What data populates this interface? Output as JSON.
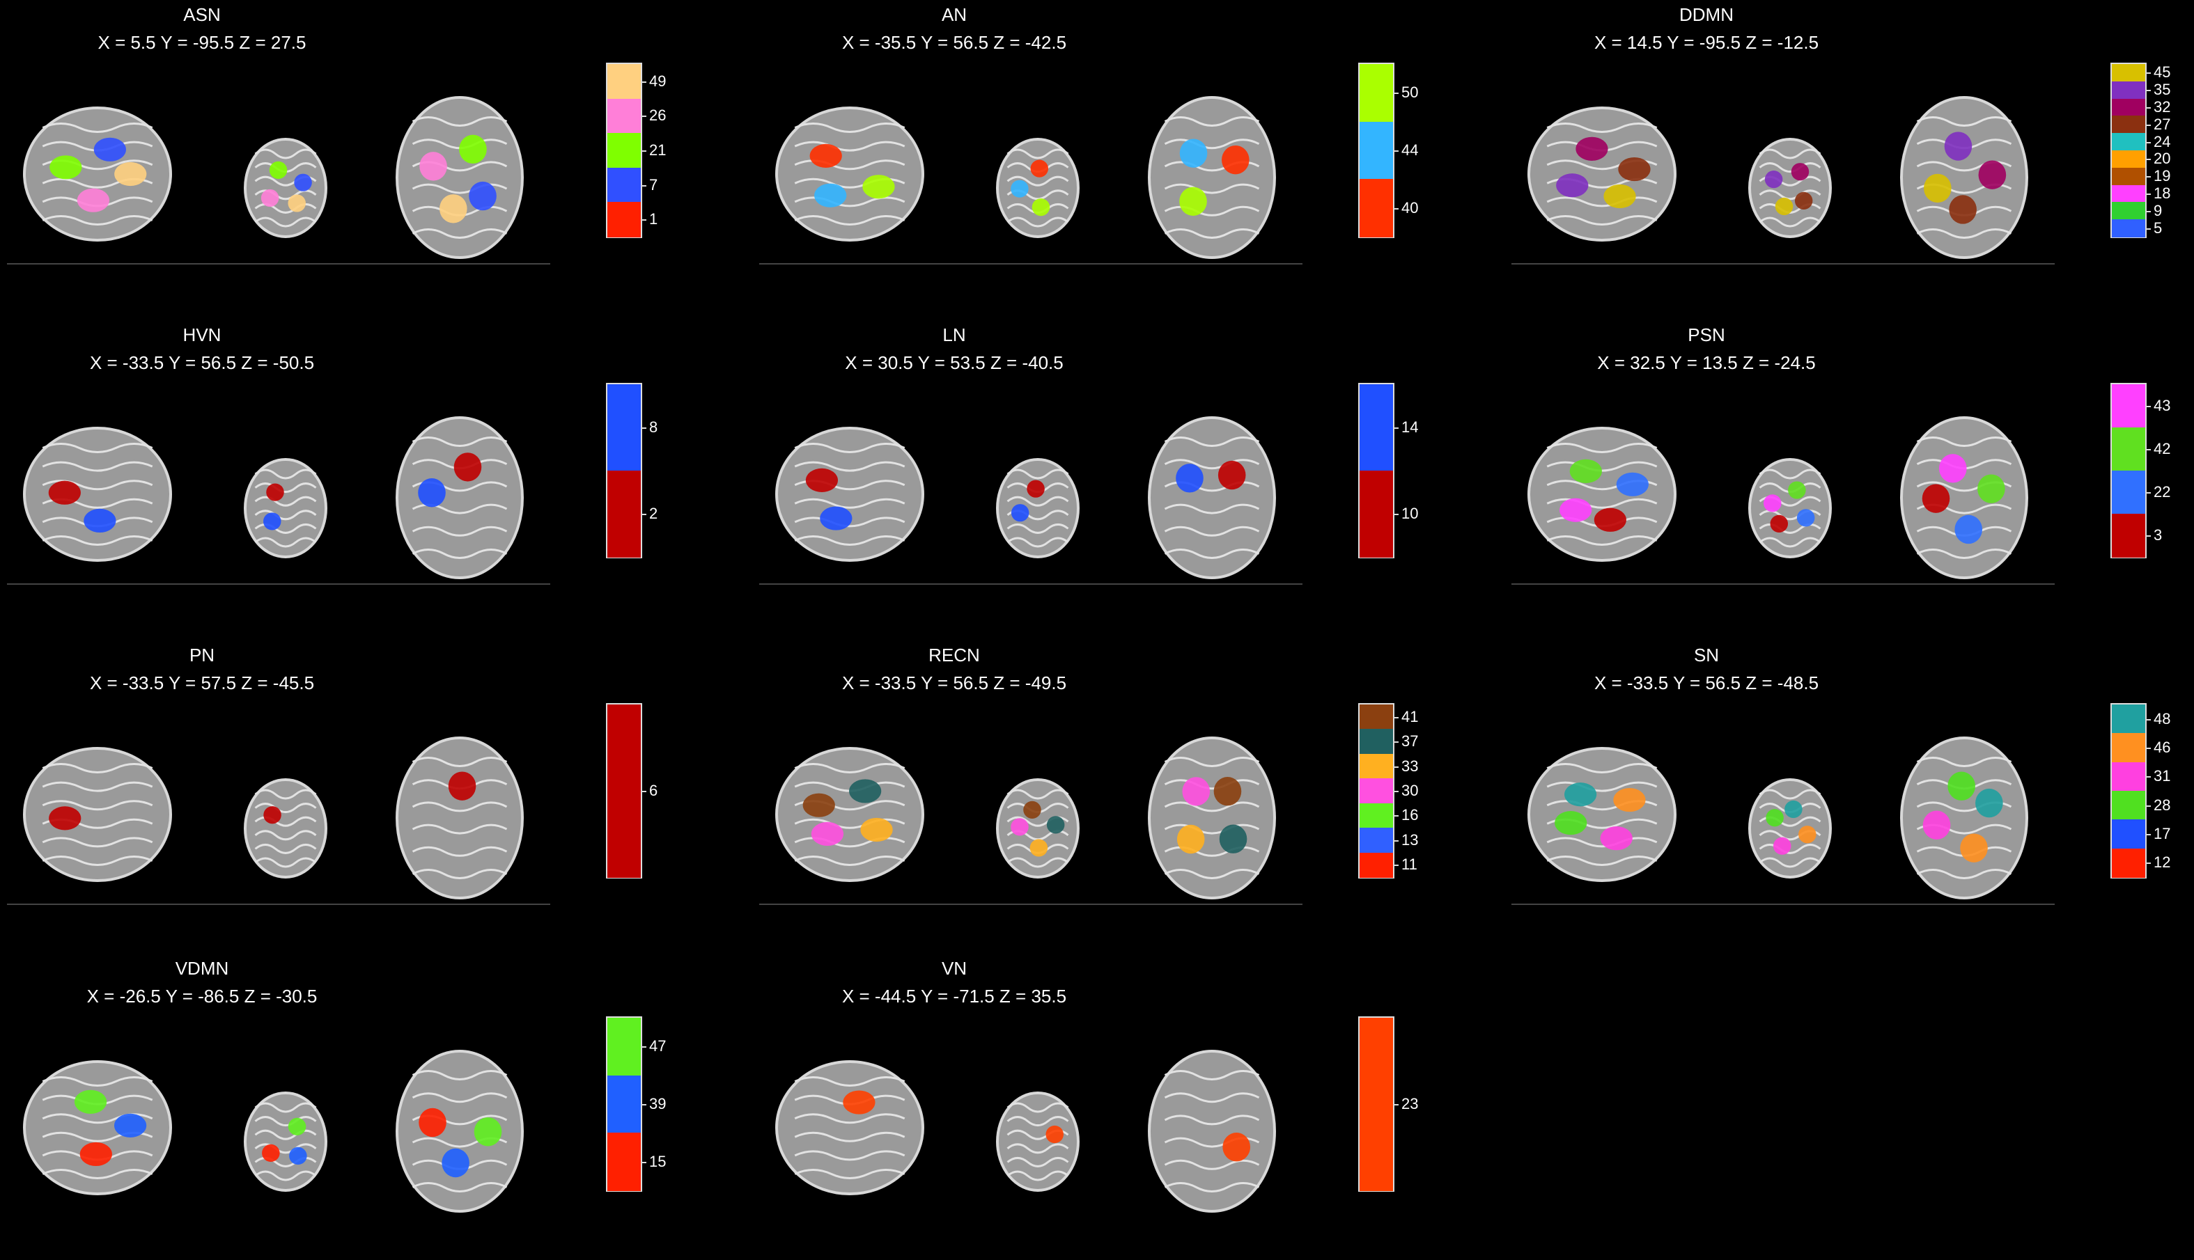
{
  "panels": [
    {
      "name": "ASN",
      "coords": "X = 5.5 Y = -95.5 Z = 27.5",
      "ticks": [
        "49",
        "26",
        "21",
        "7",
        "1"
      ],
      "colors": [
        "#ffd080",
        "#ff7fd8",
        "#7fff00",
        "#3050ff",
        "#ff2000"
      ]
    },
    {
      "name": "AN",
      "coords": "X = -35.5 Y = 56.5 Z = -42.5",
      "ticks": [
        "50",
        "44",
        "40"
      ],
      "colors": [
        "#aaff00",
        "#33b5ff",
        "#ff3000"
      ]
    },
    {
      "name": "DDMN",
      "coords": "X = 14.5 Y = -95.5 Z = -12.5",
      "ticks": [
        "45",
        "35",
        "32",
        "27",
        "24",
        "20",
        "19",
        "18",
        "9",
        "5"
      ],
      "colors": [
        "#d8c000",
        "#8030c0",
        "#a00060",
        "#8b3010",
        "#20c0c0",
        "#ffa000",
        "#b05000",
        "#ff40ff",
        "#30d030",
        "#3060ff"
      ]
    },
    {
      "name": "HVN",
      "coords": "X = -33.5 Y = 56.5 Z = -50.5",
      "ticks": [
        "8",
        "2"
      ],
      "colors": [
        "#2050ff",
        "#c00000"
      ]
    },
    {
      "name": "LN",
      "coords": "X = 30.5 Y = 53.5 Z = -40.5",
      "ticks": [
        "14",
        "10"
      ],
      "colors": [
        "#2050ff",
        "#c00000"
      ]
    },
    {
      "name": "PSN",
      "coords": "X = 32.5 Y = 13.5 Z = -24.5",
      "ticks": [
        "43",
        "42",
        "22",
        "3"
      ],
      "colors": [
        "#ff40ff",
        "#60e020",
        "#3070ff",
        "#c00000"
      ]
    },
    {
      "name": "PN",
      "coords": "X = -33.5 Y = 57.5 Z = -45.5",
      "ticks": [
        "6"
      ],
      "colors": [
        "#c00000"
      ]
    },
    {
      "name": "RECN",
      "coords": "X = -33.5 Y = 56.5 Z = -49.5",
      "ticks": [
        "41",
        "37",
        "33",
        "30",
        "16",
        "13",
        "11"
      ],
      "colors": [
        "#8b4010",
        "#206060",
        "#ffb020",
        "#ff50e0",
        "#60f020",
        "#3060ff",
        "#ff2000"
      ]
    },
    {
      "name": "SN",
      "coords": "X = -33.5 Y = 56.5 Z = -48.5",
      "ticks": [
        "48",
        "46",
        "31",
        "28",
        "17",
        "12"
      ],
      "colors": [
        "#20a0a0",
        "#ff9020",
        "#ff40e0",
        "#50e020",
        "#2050ff",
        "#ff2000"
      ]
    },
    {
      "name": "VDMN",
      "coords": "X = -26.5 Y = -86.5 Z = -30.5",
      "ticks": [
        "47",
        "39",
        "15"
      ],
      "colors": [
        "#60f020",
        "#2060ff",
        "#ff2000"
      ]
    },
    {
      "name": "VN",
      "coords": "X = -44.5 Y = -71.5 Z = 35.5",
      "ticks": [
        "23"
      ],
      "colors": [
        "#ff4000"
      ]
    }
  ]
}
